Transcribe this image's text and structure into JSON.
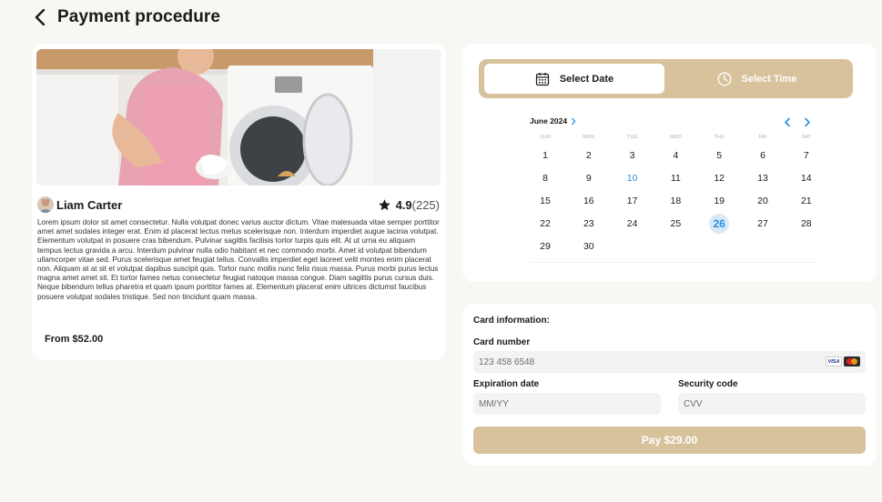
{
  "header": {
    "title": "Payment procedure"
  },
  "listing": {
    "provider_name": "Liam Carter",
    "rating": "4.9",
    "rating_count": "(225)",
    "description": "Lorem ipsum dolor sit amet consectetur. Nulla volutpat donec varius auctor dictum. Vitae malesuada vitae semper porttitor amet amet sodales integer erat. Enim id placerat lectus metus scelerisque non. Interdum imperdiet augue lacinia volutpat. Elementum volutpat in posuere cras bibendum. Pulvinar sagittis facilisis tortor turpis quis elit. At ut urna eu aliquam tempus lectus gravida a arcu. Interdum pulvinar nulla odio habitant et nec commodo morbi. Amet id volutpat bibendum ullamcorper vitae sed. Purus scelerisque amet feugiat tellus. Convallis imperdiet eget laoreet velit montes enim placerat non. Aliquam at at sit et volutpat dapibus suscipit quis. Tortor nunc mollis nunc felis risus massa. Purus morbi purus lectus magna amet amet sit. Et tortor fames netus consectetur feugiat natoque massa congue. Diam sagittis purus cursus duis. Neque bibendum tellus pharetra et quam ipsum porttitor fames at. Elementum placerat enim ultrices dictumst faucibus posuere volutpat sodales tristique. Sed non tincidunt quam massa.",
    "price": "From $52.00"
  },
  "scheduler": {
    "tab_date": "Select Date",
    "tab_time": "Select Time",
    "active_tab": "date"
  },
  "calendar": {
    "month_label": "June 2024",
    "weekdays": [
      "SUN",
      "MON",
      "TUE",
      "WED",
      "THU",
      "FRI",
      "SAT"
    ],
    "first_weekday_index": 0,
    "days_in_month": 30,
    "today": 10,
    "selected": 26,
    "accent_color": "#2a8fdb"
  },
  "payment": {
    "section_title": "Card information:",
    "card_number_label": "Card number",
    "card_number_value": "123 458 6548",
    "card_brands": [
      "visa",
      "mastercard"
    ],
    "visa_text": "VISA",
    "expiration_label": "Expiration date",
    "expiration_placeholder": "MM/YY",
    "security_label": "Security code",
    "security_placeholder": "CVV",
    "pay_button": "Pay $29.00"
  },
  "colors": {
    "accent": "#d7c29c",
    "background": "#f8f7f4",
    "link": "#2a8fdb"
  }
}
